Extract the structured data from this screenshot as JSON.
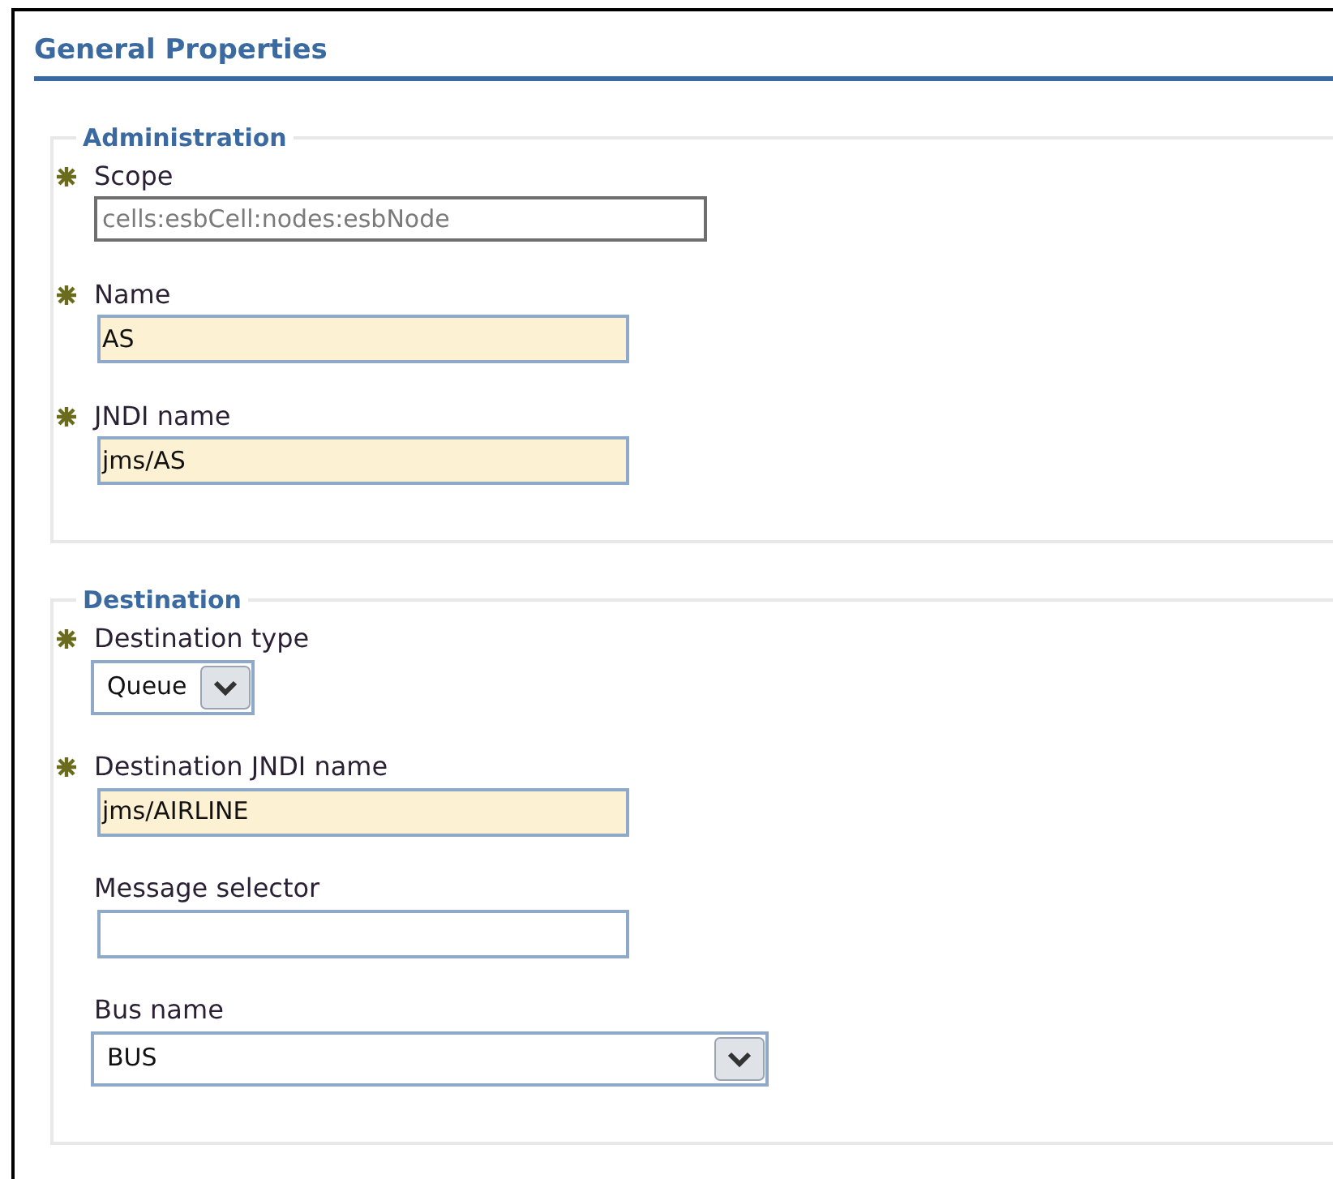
{
  "title": "General Properties",
  "sections": [
    {
      "legend": "Administration",
      "fields": [
        {
          "label": "Scope",
          "required": true,
          "kind": "readonly",
          "value": "cells:esbCell:nodes:esbNode"
        },
        {
          "label": "Name",
          "required": true,
          "kind": "text",
          "value": "AS"
        },
        {
          "label": "JNDI name",
          "required": true,
          "kind": "text",
          "value": "jms/AS"
        }
      ]
    },
    {
      "legend": "Destination",
      "fields": [
        {
          "label": "Destination type",
          "required": true,
          "kind": "select",
          "value": "Queue"
        },
        {
          "label": "Destination JNDI name",
          "required": true,
          "kind": "text",
          "value": "jms/AIRLINE"
        },
        {
          "label": "Message selector",
          "required": false,
          "kind": "text"
        },
        {
          "label": "Bus name",
          "required": false,
          "kind": "select",
          "value": "BUS"
        }
      ]
    }
  ]
}
